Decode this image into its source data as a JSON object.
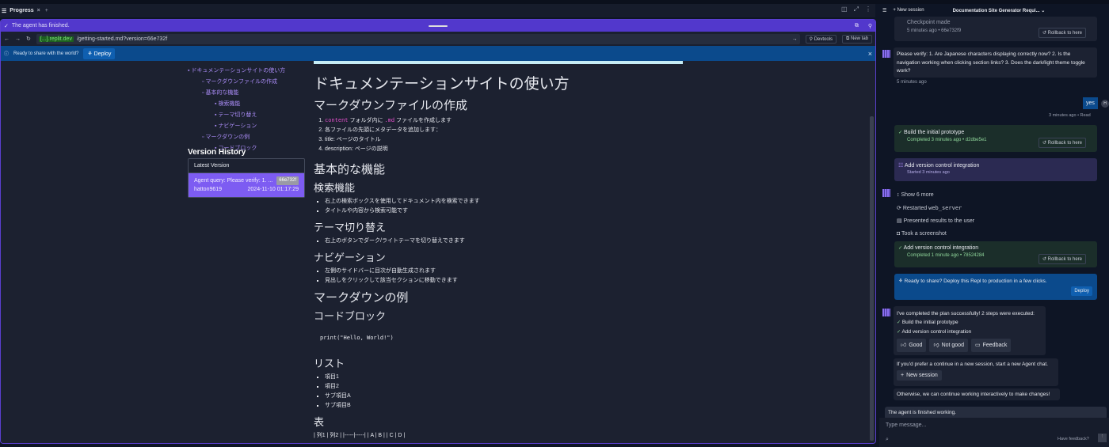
{
  "tabs": {
    "progress": "Progress",
    "close": "×",
    "add": "+"
  },
  "banner": {
    "finished": "The agent has finished."
  },
  "browser": {
    "domain": "[...].replit.dev",
    "path": "/getting-started.md?version=66e732f",
    "devtools": "Devtools",
    "newtab": "New tab"
  },
  "deploybar": {
    "text": "Ready to share with the world?",
    "deploy": "Deploy",
    "close": "×"
  },
  "toc": [
    "ドキュメンテーションサイトの使い方",
    "マークダウンファイルの作成",
    "基本的な機能",
    "検索機能",
    "テーマ切り替え",
    "ナビゲーション",
    "マークダウンの例",
    "コードブロック"
  ],
  "version_history": {
    "title": "Version History",
    "latest": "Latest Version",
    "query": "Agent query: Please verify: 1. ...",
    "hash": "66e732f",
    "user": "hatton9619",
    "date": "2024-11-10 01:17:29"
  },
  "doc": {
    "h1": "ドキュメンテーションサイトの使い方",
    "s1": "マークダウンファイルの作成",
    "s1_items": [
      {
        "code": "content",
        "text": " フォルダ内に "
      },
      {
        "code": ".md",
        "text": " ファイルを作成します"
      }
    ],
    "s1_rest": [
      "各ファイルの先頭にメタデータを追加します：",
      "title: ページのタイトル",
      "description: ページの説明"
    ],
    "s2": "基本的な機能",
    "search": "検索機能",
    "search_items": [
      "右上の検索ボックスを使用してドキュメント内を検索できます",
      "タイトルや内容から検索可能です"
    ],
    "theme": "テーマ切り替え",
    "theme_items": [
      "右上のボタンでダーク/ライトテーマを切り替えできます"
    ],
    "nav": "ナビゲーション",
    "nav_items": [
      "左側のサイドバーに目次が自動生成されます",
      "見出しをクリックして該当セクションに移動できます"
    ],
    "s3": "マークダウンの例",
    "codeblock": "コードブロック",
    "code": "print(\"Hello, World!\")",
    "list": "リスト",
    "list_items": [
      "項目1",
      "項目2",
      "サブ項目A",
      "サブ項目B"
    ],
    "table": "表",
    "table_raw": "| 列1 | 列2 | |-----|-----| | A | B | | C | D |"
  },
  "chat": {
    "new_session": "New session",
    "session_title": "Documentation Site Generator Requi...",
    "checkpoint": "Checkpoint made",
    "checkpoint_meta": "5 minutes ago • 66e732f9",
    "rollback": "Rollback to here",
    "verify_msg": "Please verify: 1. Are Japanese characters displaying correctly now? 2. Is the navigation working when clicking section links? 3. Does the dark/light theme toggle work?",
    "verify_time": "5 minutes ago",
    "user_msg": "yes",
    "user_avatar": "H",
    "user_time": "3 minutes ago • Read",
    "step1": "Build the initial prototype",
    "step1_meta": "Completed 3 minutes ago • d2dbe5e1",
    "step2": "Add version control integration",
    "step2_meta": "Started 3 minutes ago",
    "show_more": "Show 6 more",
    "restarted": "Restarted ",
    "restarted_code": "web_server",
    "presented": "Presented results to the user",
    "screenshot": "Took a screenshot",
    "step2_done_meta": "Completed 1 minute ago • 78524284",
    "share": "Ready to share? Deploy this Repl to production in a few clicks.",
    "deploy": "Deploy",
    "completed": "I've completed the plan successfully! 2 steps were executed:",
    "good": "Good",
    "not_good": "Not good",
    "feedback": "Feedback",
    "prefer": "If you'd prefer a continue in a new session, start a new Agent chat.",
    "otherwise": "Otherwise, we can continue working interactively to make changes!",
    "finished": "The agent is finished working.",
    "placeholder": "Type message...",
    "have_feedback": "Have feedback?"
  }
}
